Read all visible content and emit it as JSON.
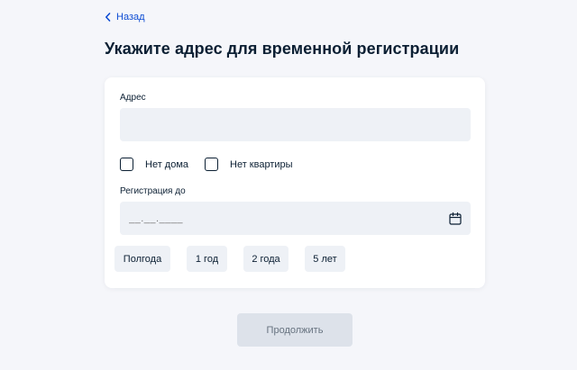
{
  "nav": {
    "back_label": "Назад",
    "back_icon": "chevron-left-icon"
  },
  "page": {
    "title": "Укажите адрес для временной регистрации"
  },
  "form": {
    "address": {
      "label": "Адрес",
      "value": ""
    },
    "checkboxes": [
      {
        "label": "Нет дома",
        "checked": false
      },
      {
        "label": "Нет квартиры",
        "checked": false
      }
    ],
    "registration_until": {
      "label": "Регистрация до",
      "placeholder": "__.__.____",
      "icon": "calendar-icon"
    },
    "period_chips": [
      {
        "label": "Полгода"
      },
      {
        "label": "1 год"
      },
      {
        "label": "2 года"
      },
      {
        "label": "5 лет"
      }
    ],
    "submit_label": "Продолжить",
    "submit_disabled": true
  },
  "colors": {
    "background": "#f5f6fa",
    "card": "#ffffff",
    "link": "#0d4cd3",
    "text": "#0b1f33",
    "input_bg": "#eef1f6",
    "disabled_button": "#dde2ea"
  }
}
